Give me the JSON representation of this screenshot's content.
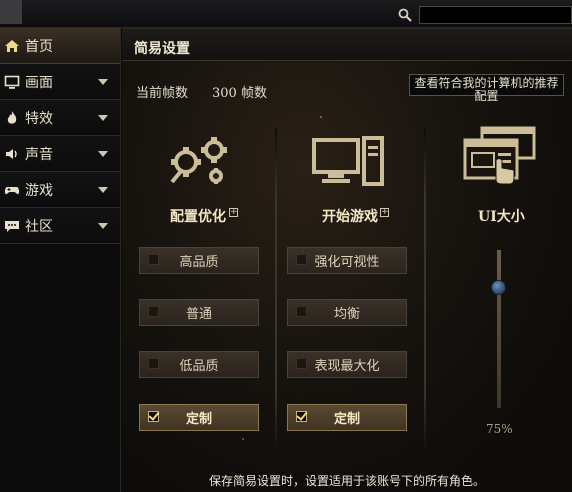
{
  "search": {
    "placeholder": ""
  },
  "sidebar": {
    "items": [
      {
        "label": "首页",
        "icon": "home-icon",
        "active": true
      },
      {
        "label": "画面",
        "icon": "monitor-icon"
      },
      {
        "label": "特效",
        "icon": "flame-icon"
      },
      {
        "label": "声音",
        "icon": "speaker-icon"
      },
      {
        "label": "游戏",
        "icon": "gamepad-icon"
      },
      {
        "label": "社区",
        "icon": "chat-icon"
      }
    ]
  },
  "main": {
    "title": "简易设置",
    "framerate": {
      "label": "当前帧数",
      "value": "300 帧数"
    },
    "recommend": {
      "line1": "查看符合我的计算机的推荐",
      "line2": "配置"
    },
    "columns": {
      "config": {
        "title": "配置优化",
        "icon": "gears-icon",
        "options": [
          {
            "label": "高品质",
            "selected": false
          },
          {
            "label": "普通",
            "selected": false
          },
          {
            "label": "低品质",
            "selected": false
          },
          {
            "label": "定制",
            "selected": true
          }
        ]
      },
      "start": {
        "title": "开始游戏",
        "icon": "computer-icon",
        "options": [
          {
            "label": "强化可视性",
            "selected": false
          },
          {
            "label": "均衡",
            "selected": false
          },
          {
            "label": "表现最大化",
            "selected": false
          },
          {
            "label": "定制",
            "selected": true
          }
        ]
      },
      "ui": {
        "title": "UI大小",
        "icon": "window-pointer-icon",
        "slider_value": "75%",
        "slider_fraction": 0.75
      }
    },
    "footer": "保存简易设置时，设置适用于该账号下的所有角色。"
  },
  "colors": {
    "accent": "#c9b078",
    "slider_handle": "#4b6d99",
    "panel_bg": "#0d0c0a"
  }
}
